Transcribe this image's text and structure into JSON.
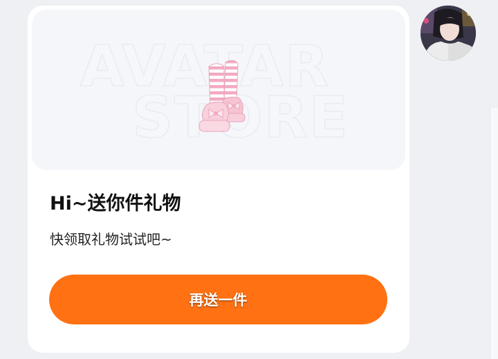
{
  "gift_card": {
    "watermark_line1": "AVATAR",
    "watermark_line2": "STORE",
    "item_icon": "pink-striped-platform-boots-icon",
    "title": "Hi~送你件礼物",
    "subtitle": "快领取礼物试试吧~",
    "send_button_label": "再送一件"
  },
  "sender": {
    "avatar_icon": "user-avatar-photo"
  },
  "colors": {
    "page_background": "#eef0f4",
    "card_background": "#ffffff",
    "preview_background": "#f4f6fa",
    "button_background": "#ff7112",
    "button_text": "#ffffff",
    "title_text": "#111111"
  }
}
